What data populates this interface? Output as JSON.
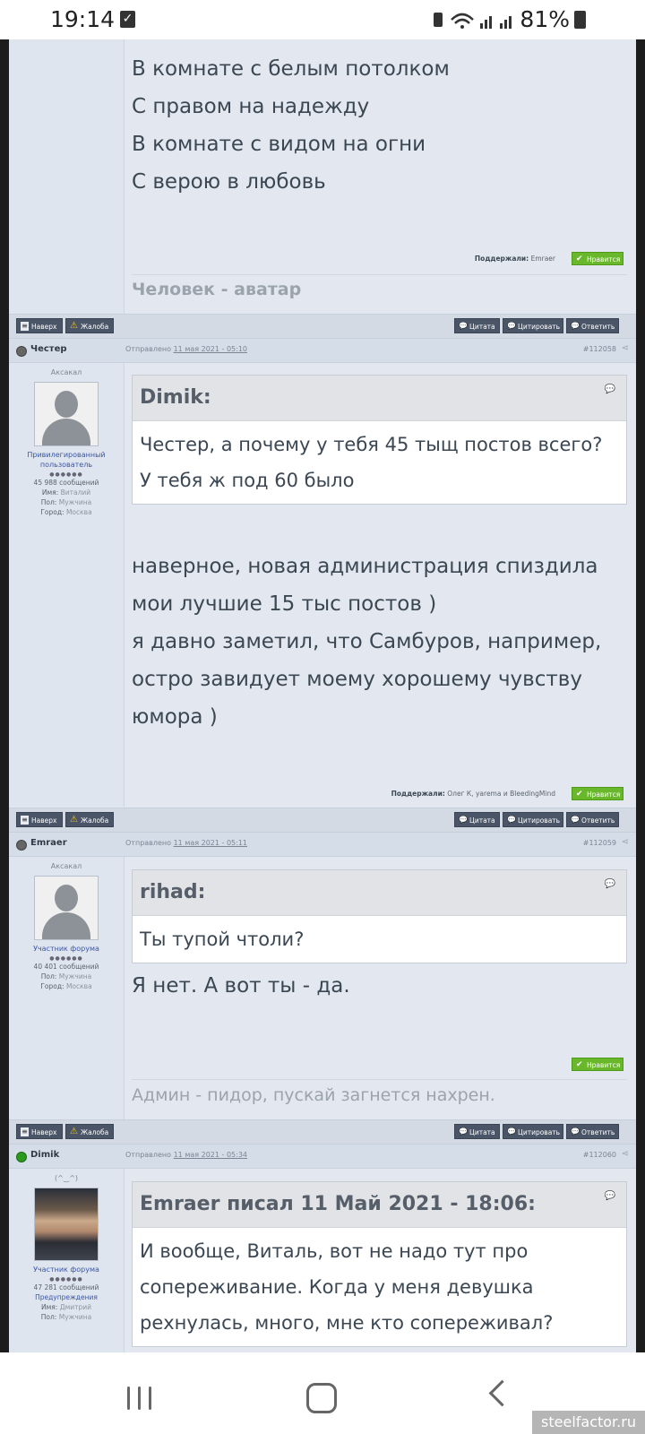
{
  "status_bar": {
    "time": "19:14",
    "battery": "81%"
  },
  "post0": {
    "lines": [
      "В комнате с белым потолком",
      "С правом на надежду",
      "В комнате с видом на огни",
      "С верою в любовь"
    ],
    "supported_label": "Поддержали:",
    "supported_by": "Emraer",
    "like_label": "Нравится",
    "signature": "Человек - аватар"
  },
  "toolbar": {
    "top": "Наверх",
    "report": "Жалоба",
    "quote": "Цитата",
    "multiquote": "Цитировать",
    "reply": "Ответить"
  },
  "post1": {
    "username": "Честер",
    "sent_prefix": "Отправлено",
    "date": "11 мая 2021 - 05:10",
    "id": "#112058",
    "rank": "Аксакал",
    "role": "Привилегированный пользователь",
    "stars": "●●●●●●",
    "posts": "45 988 сообщений",
    "name_label": "Имя:",
    "name": "Виталий",
    "sex_label": "Пол:",
    "sex": "Мужчина",
    "city_label": "Город:",
    "city": "Москва",
    "quote_author": "Dimik:",
    "quote_lines": [
      "Честер, а почему у тебя 45 тыщ постов всего?",
      "У тебя ж под 60 было"
    ],
    "lines": [
      "наверное, новая администрация спиздила",
      "мои лучшие 15 тыс постов )",
      "я давно заметил, что Самбуров, например,",
      "остро завидует моему хорошему чувству",
      "юмора )"
    ],
    "supported_label": "Поддержали:",
    "supported_by": "Олег К, yarema и BleedingMind",
    "like_label": "Нравится"
  },
  "post2": {
    "username": "Emraer",
    "sent_prefix": "Отправлено",
    "date": "11 мая 2021 - 05:11",
    "id": "#112059",
    "rank": "Аксакал",
    "role": "Участник форума",
    "stars": "●●●●●●",
    "posts": "40 401 сообщений",
    "sex_label": "Пол:",
    "sex": "Мужчина",
    "city_label": "Город:",
    "city": "Москва",
    "quote_author": "rihad:",
    "quote_lines": [
      "Ты тупой чтоли?"
    ],
    "lines": [
      "Я нет. А вот ты - да."
    ],
    "like_label": "Нравится",
    "signature": "Админ - пидор, пускай загнется нахрен."
  },
  "post3": {
    "username": "Dimik",
    "sent_prefix": "Отправлено",
    "date": "11 мая 2021 - 05:34",
    "id": "#112060",
    "rank": "(^‿^)",
    "role": "Участник форума",
    "stars": "●●●●●●",
    "posts": "47 281 сообщений",
    "warnings": "Предупреждения",
    "name_label": "Имя:",
    "name": "Дмитрий",
    "sex_label": "Пол:",
    "sex": "Мужчина",
    "quote_author": "Emraer писал 11 Май 2021 - 18:06:",
    "quote_lines": [
      "И вообще, Виталь, вот не надо тут про",
      "сопереживание. Когда у меня девушка",
      "рехнулась, много, мне кто сопереживал?"
    ]
  },
  "watermark": "steelfactor.ru"
}
